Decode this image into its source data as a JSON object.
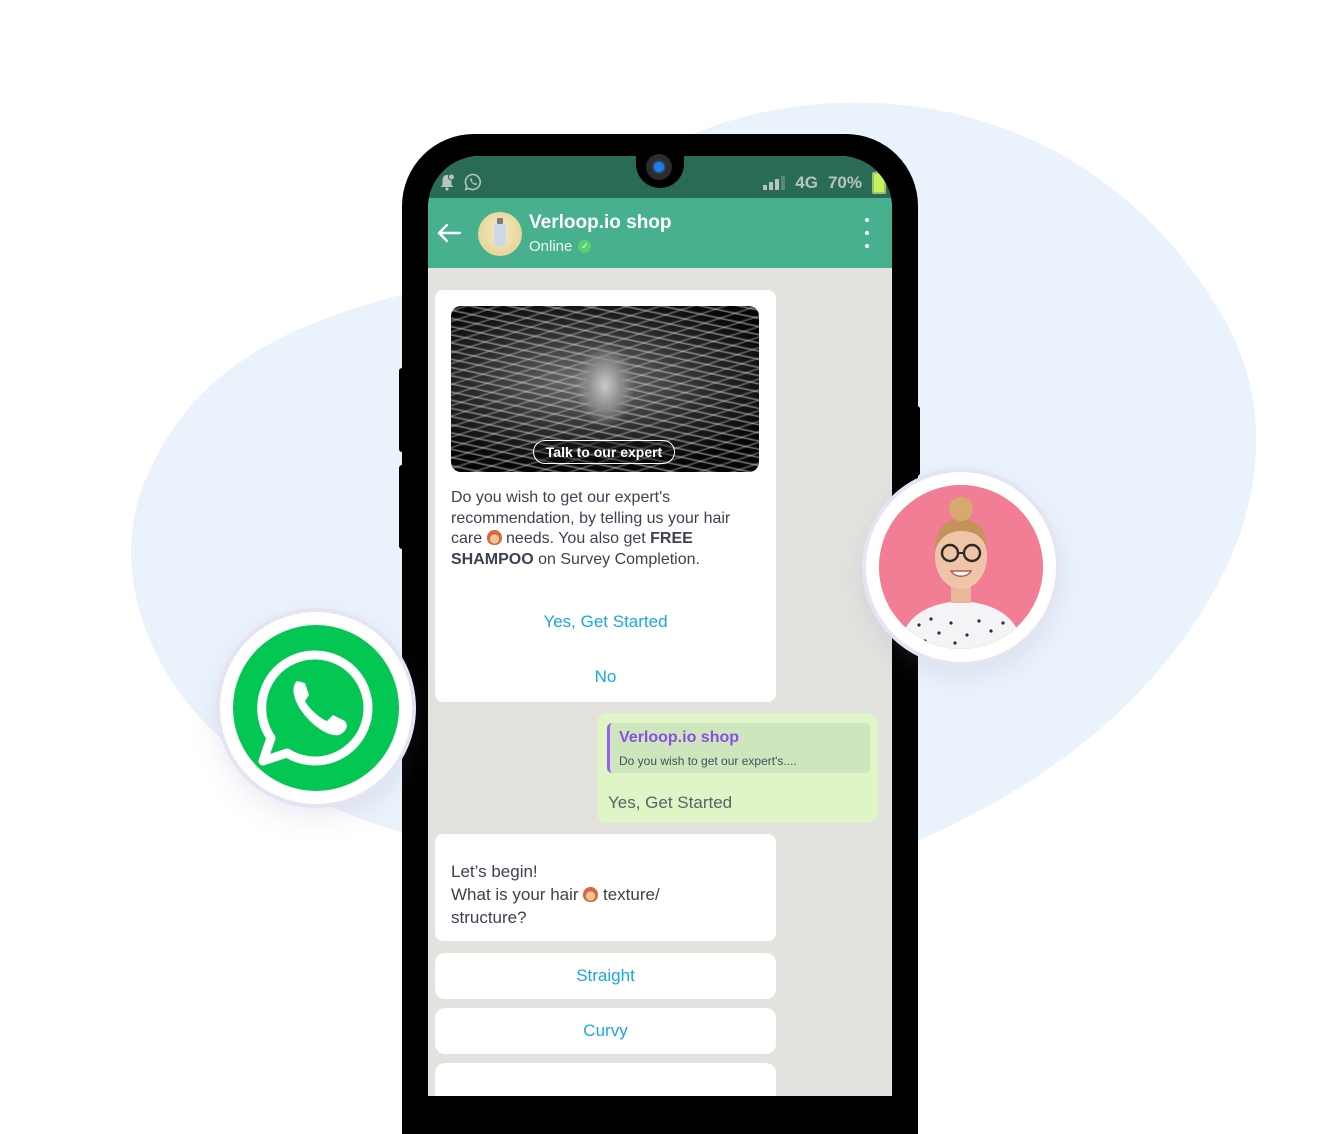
{
  "status_bar": {
    "notification_icon": "bell-icon",
    "app_icon": "whatsapp-icon",
    "network": "4G",
    "battery": "70%"
  },
  "chat_header": {
    "back_icon": "arrow-left-icon",
    "title": "Verloop.io shop",
    "status": "Online",
    "verified_icon": "check-circle-icon",
    "menu_icon": "kebab-menu-icon"
  },
  "messages": {
    "intro": {
      "image_button": "Talk to our expert",
      "text_part1": "Do you wish to get our expert's recommendation, by telling us your hair care ",
      "text_part2": " needs. You also get ",
      "text_bold1": "FREE SHAMPOO",
      "text_part3": " on Survey Completion.",
      "emoji": "woman-red-hair-emoji",
      "quick_replies": [
        "Yes, Get Started",
        "No"
      ]
    },
    "reply": {
      "quote_author": "Verloop.io shop",
      "quote_text": "Do you wish to get our expert's....",
      "text": "Yes, Get Started"
    },
    "question": {
      "line1": "Let’s begin!",
      "line2a": "What is your hair ",
      "line2b": " texture/",
      "line3": "structure?",
      "options": [
        "Straight",
        "Curvy",
        ""
      ]
    }
  },
  "badges": {
    "left": "whatsapp-logo",
    "right": "support-agent-photo"
  },
  "colors": {
    "header_green": "#47b08f",
    "status_green": "#2a6b58",
    "whatsapp_green": "#03c653",
    "link_blue": "#1aa7e0",
    "sent_bubble": "#dff5c6",
    "quote_purple": "#8a4fe0"
  }
}
